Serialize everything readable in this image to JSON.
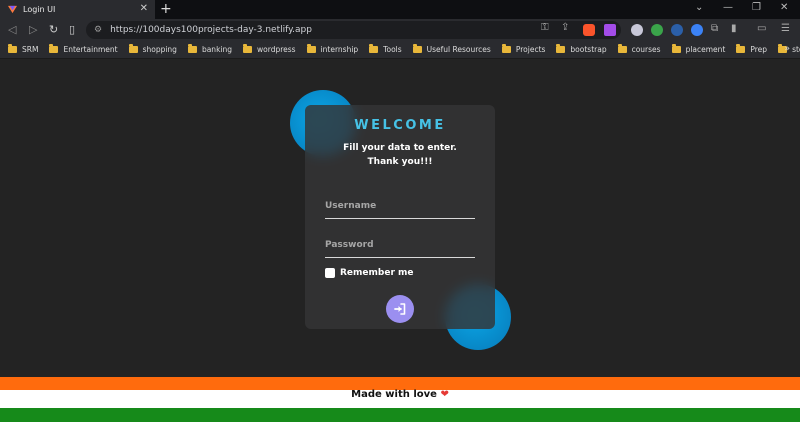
{
  "browser": {
    "tab_title": "Login UI",
    "tab_close": "✕",
    "new_tab": "+",
    "url": "https://100days100projects-day-3.netlify.app",
    "window_controls": [
      "⌄",
      "—",
      "❐",
      "✕"
    ],
    "bookmarks": [
      "SRM",
      "Entertainment",
      "shopping",
      "banking",
      "wordpress",
      "internship",
      "Tools",
      "Useful Resources",
      "Projects",
      "bootstrap",
      "courses",
      "placement",
      "Prep",
      "stocks"
    ],
    "bookmarks_more": "»"
  },
  "login": {
    "heading": "WELCOME",
    "subtitle_line1": "Fill your data to enter.",
    "subtitle_line2": "Thank you!!!",
    "username_placeholder": "Username",
    "password_placeholder": "Password",
    "remember_label": "Remember me",
    "login_icon": "sign-in-icon"
  },
  "footer": {
    "text": "Made with love",
    "heart": "❤"
  },
  "colors": {
    "accent_blue": "#46c2e6",
    "blob_blue": "#0aa6e6",
    "button_purple": "#9b8ff0",
    "flag_orange": "#ff6b0d",
    "flag_green": "#168a1a"
  }
}
